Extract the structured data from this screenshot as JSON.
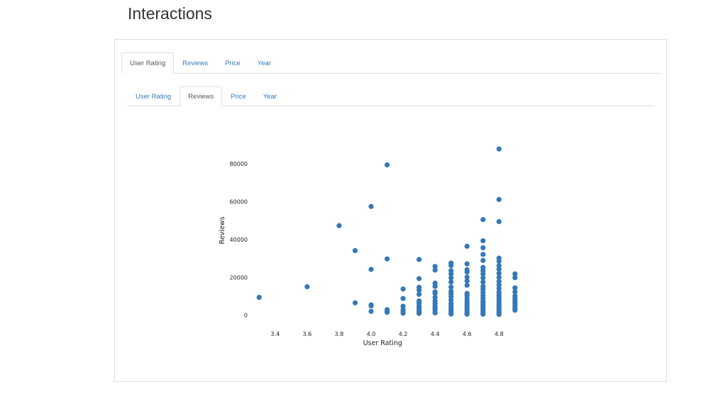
{
  "page": {
    "title": "Interactions"
  },
  "outer_tabs": [
    {
      "label": "User Rating",
      "active": true
    },
    {
      "label": "Reviews",
      "active": false
    },
    {
      "label": "Price",
      "active": false
    },
    {
      "label": "Year",
      "active": false
    }
  ],
  "inner_tabs": [
    {
      "label": "User Rating",
      "active": false
    },
    {
      "label": "Reviews",
      "active": true
    },
    {
      "label": "Price",
      "active": false
    },
    {
      "label": "Year",
      "active": false
    }
  ],
  "chart_data": {
    "type": "scatter",
    "title": "",
    "xlabel": "User Rating",
    "ylabel": "Reviews",
    "xlim": [
      3.25,
      4.95
    ],
    "ylim": [
      -2000,
      92000
    ],
    "xticks": [
      3.4,
      3.6,
      3.8,
      4.0,
      4.2,
      4.4,
      4.6,
      4.8
    ],
    "xtick_labels": [
      "3.4",
      "3.6",
      "3.8",
      "4.0",
      "4.2",
      "4.4",
      "4.6",
      "4.8"
    ],
    "yticks": [
      0,
      20000,
      40000,
      60000,
      80000
    ],
    "ytick_labels": [
      "0",
      "20000",
      "40000",
      "60000",
      "80000"
    ],
    "grid": false,
    "point_color": "#3478b8",
    "points": [
      [
        3.3,
        9400
      ],
      [
        3.6,
        15000
      ],
      [
        3.8,
        47300
      ],
      [
        3.9,
        34100
      ],
      [
        3.9,
        6500
      ],
      [
        4.0,
        57400
      ],
      [
        4.0,
        24200
      ],
      [
        4.0,
        5400
      ],
      [
        4.0,
        4900
      ],
      [
        4.0,
        2000
      ],
      [
        4.1,
        79400
      ],
      [
        4.1,
        29700
      ],
      [
        4.1,
        2900
      ],
      [
        4.1,
        2000
      ],
      [
        4.1,
        1500
      ],
      [
        4.2,
        13800
      ],
      [
        4.2,
        8800
      ],
      [
        4.2,
        4700
      ],
      [
        4.2,
        2900
      ],
      [
        4.2,
        1800
      ],
      [
        4.2,
        1000
      ],
      [
        4.3,
        29400
      ],
      [
        4.3,
        19300
      ],
      [
        4.3,
        14700
      ],
      [
        4.3,
        13200
      ],
      [
        4.3,
        11000
      ],
      [
        4.3,
        7500
      ],
      [
        4.3,
        6300
      ],
      [
        4.3,
        4800
      ],
      [
        4.3,
        3900
      ],
      [
        4.3,
        2800
      ],
      [
        4.3,
        1700
      ],
      [
        4.3,
        900
      ],
      [
        4.4,
        25700
      ],
      [
        4.4,
        23800
      ],
      [
        4.4,
        16900
      ],
      [
        4.4,
        15200
      ],
      [
        4.4,
        12300
      ],
      [
        4.4,
        11500
      ],
      [
        4.4,
        9400
      ],
      [
        4.4,
        7600
      ],
      [
        4.4,
        6200
      ],
      [
        4.4,
        4800
      ],
      [
        4.4,
        3700
      ],
      [
        4.4,
        2500
      ],
      [
        4.4,
        1200
      ],
      [
        4.5,
        27500
      ],
      [
        4.5,
        26200
      ],
      [
        4.5,
        23500
      ],
      [
        4.5,
        21800
      ],
      [
        4.5,
        19700
      ],
      [
        4.5,
        17500
      ],
      [
        4.5,
        14800
      ],
      [
        4.5,
        12600
      ],
      [
        4.5,
        11200
      ],
      [
        4.5,
        9800
      ],
      [
        4.5,
        8100
      ],
      [
        4.5,
        6400
      ],
      [
        4.5,
        5000
      ],
      [
        4.5,
        3800
      ],
      [
        4.5,
        2600
      ],
      [
        4.5,
        1500
      ],
      [
        4.5,
        600
      ],
      [
        4.6,
        36400
      ],
      [
        4.6,
        27100
      ],
      [
        4.6,
        24000
      ],
      [
        4.6,
        22800
      ],
      [
        4.6,
        20100
      ],
      [
        4.6,
        18100
      ],
      [
        4.6,
        15800
      ],
      [
        4.6,
        11500
      ],
      [
        4.6,
        10300
      ],
      [
        4.6,
        8700
      ],
      [
        4.6,
        7200
      ],
      [
        4.6,
        5800
      ],
      [
        4.6,
        4500
      ],
      [
        4.6,
        3400
      ],
      [
        4.6,
        2200
      ],
      [
        4.6,
        1200
      ],
      [
        4.6,
        500
      ],
      [
        4.7,
        50500
      ],
      [
        4.7,
        39300
      ],
      [
        4.7,
        35600
      ],
      [
        4.7,
        32100
      ],
      [
        4.7,
        28900
      ],
      [
        4.7,
        25200
      ],
      [
        4.7,
        23500
      ],
      [
        4.7,
        21800
      ],
      [
        4.7,
        19700
      ],
      [
        4.7,
        17500
      ],
      [
        4.7,
        15200
      ],
      [
        4.7,
        13700
      ],
      [
        4.7,
        12000
      ],
      [
        4.7,
        10400
      ],
      [
        4.7,
        8900
      ],
      [
        4.7,
        7300
      ],
      [
        4.7,
        6100
      ],
      [
        4.7,
        4800
      ],
      [
        4.7,
        3600
      ],
      [
        4.7,
        2400
      ],
      [
        4.7,
        1300
      ],
      [
        4.7,
        500
      ],
      [
        4.8,
        87800
      ],
      [
        4.8,
        61100
      ],
      [
        4.8,
        49400
      ],
      [
        4.8,
        30100
      ],
      [
        4.8,
        28500
      ],
      [
        4.8,
        26100
      ],
      [
        4.8,
        24300
      ],
      [
        4.8,
        22100
      ],
      [
        4.8,
        20000
      ],
      [
        4.8,
        17800
      ],
      [
        4.8,
        15900
      ],
      [
        4.8,
        14100
      ],
      [
        4.8,
        12200
      ],
      [
        4.8,
        10700
      ],
      [
        4.8,
        9300
      ],
      [
        4.8,
        8000
      ],
      [
        4.8,
        6800
      ],
      [
        4.8,
        5600
      ],
      [
        4.8,
        4300
      ],
      [
        4.8,
        3200
      ],
      [
        4.8,
        2200
      ],
      [
        4.8,
        1200
      ],
      [
        4.8,
        400
      ],
      [
        4.9,
        21800
      ],
      [
        4.9,
        19800
      ],
      [
        4.9,
        14400
      ],
      [
        4.9,
        12300
      ],
      [
        4.9,
        10100
      ],
      [
        4.9,
        8600
      ],
      [
        4.9,
        7400
      ],
      [
        4.9,
        6200
      ],
      [
        4.9,
        4900
      ],
      [
        4.9,
        3800
      ],
      [
        4.9,
        2600
      ]
    ]
  }
}
